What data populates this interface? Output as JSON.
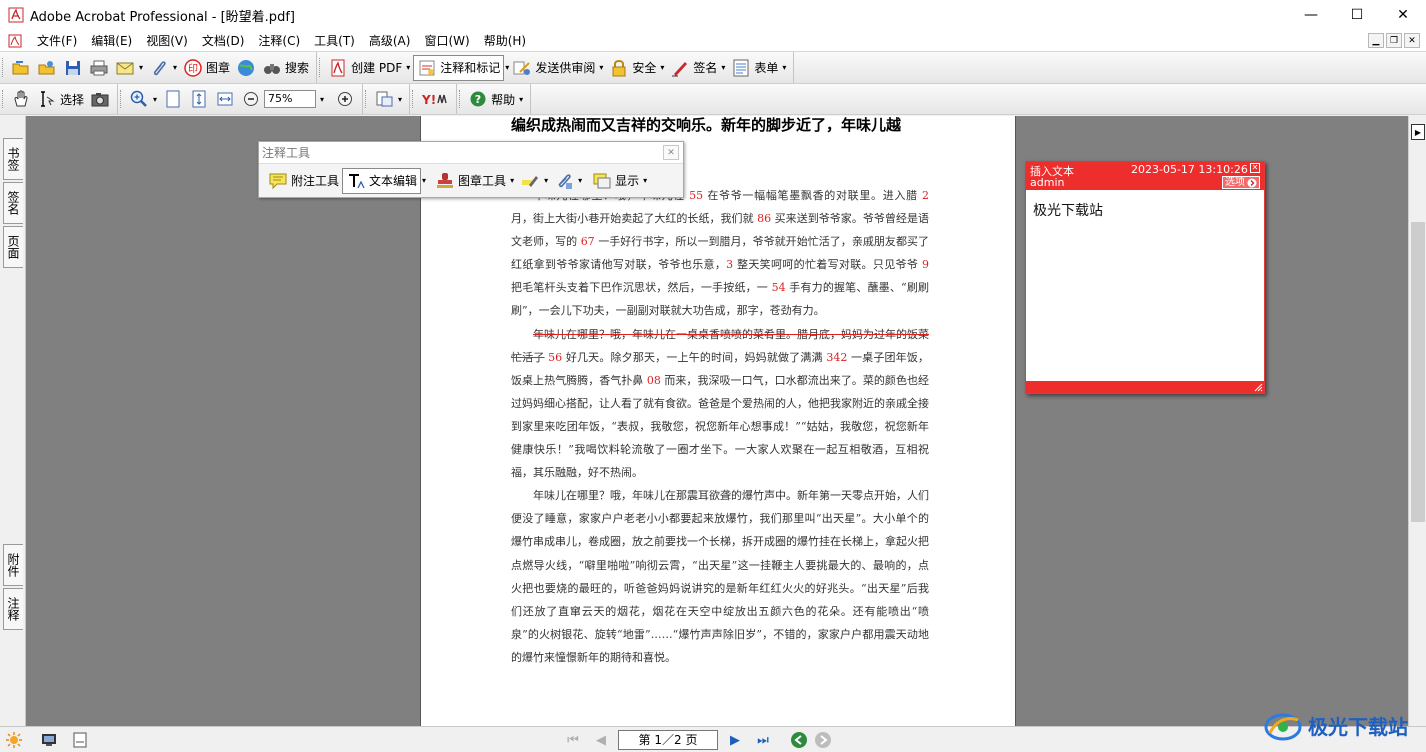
{
  "window": {
    "title": "Adobe Acrobat Professional - [盼望着.pdf]",
    "min": "—",
    "max": "☐",
    "close": "✕"
  },
  "menu": [
    "文件(F)",
    "编辑(E)",
    "视图(V)",
    "文档(D)",
    "注释(C)",
    "工具(T)",
    "高级(A)",
    "窗口(W)",
    "帮助(H)"
  ],
  "toolbar1": {
    "stamp": "图章",
    "search": "搜索",
    "create_pdf": "创建 PDF",
    "comment_markup": "注释和标记",
    "send_review": "发送供审阅",
    "security": "安全",
    "sign": "签名",
    "forms": "表单"
  },
  "toolbar2": {
    "select": "选择",
    "zoom_value": "75%",
    "help": "帮助"
  },
  "nav_tabs": {
    "bookmarks": "书签",
    "signatures": "签名",
    "pages": "页面",
    "attachments": "附件",
    "comments": "注释"
  },
  "comment_toolbar": {
    "title": "注释工具",
    "note_tool": "附注工具",
    "text_edit": "文本编辑",
    "stamp_tool": "图章工具",
    "show": "显示"
  },
  "sticky_note": {
    "type_label": "插入文本",
    "author": "admin",
    "timestamp": "2023-05-17 13:10:26",
    "options_label": "选项",
    "content": "极光下载站"
  },
  "document": {
    "heading": "编织成热闹而又吉祥的交响乐。新年的脚步近了，年味儿越",
    "p1": [
      {
        "t": "年味儿在哪里？哦，年味儿在 "
      },
      {
        "n": "55"
      },
      {
        "t": " 在爷爷一幅幅笔墨飘香的对联里。进入腊 "
      },
      {
        "n": "2"
      },
      {
        "t": " 月，街上大街小巷开始卖起了大红的长纸，我们就 "
      },
      {
        "n": "86"
      },
      {
        "t": " 买来送到爷爷家。爷爷曾经是语文老师，写的 "
      },
      {
        "n": "67"
      },
      {
        "t": " 一手好行书字，所以一到腊月，爷爷就开始忙活了，亲戚朋友都买了红纸拿到爷爷家请他写对联，爷爷也乐意，"
      },
      {
        "n": "3"
      },
      {
        "t": " 整天笑呵呵的忙着写对联。只见爷爷 "
      },
      {
        "n": "9"
      },
      {
        "t": " 把毛笔杆头支着下巴作沉思状，然后，一手按纸，一 "
      },
      {
        "n": "54"
      },
      {
        "t": " 手有力的握笔、蘸墨、“刷刷刷”，一会儿下功夫，一副副对联就大功告成，那字，苍劲有力。"
      }
    ],
    "p2": [
      {
        "s": "年味儿在哪里？哦，年味儿在一桌桌香喷喷的菜肴里。腊月底，妈妈为过年的饭菜忙活了"
      },
      {
        "t": " "
      },
      {
        "n": "56"
      },
      {
        "t": " 好几天。除夕那天，一上午的时间，妈妈就做了满满 "
      },
      {
        "n": "342"
      },
      {
        "t": " 一桌子团年饭，饭桌上热气腾腾，香气扑鼻 "
      },
      {
        "n": "08"
      },
      {
        "t": " 而来，我深吸一口气，口水都流出来了。菜的颜色也经过妈妈细心搭配，让人看了就有食欲。爸爸是个爱热闹的人，他把我家附近的亲戚全接到家里来吃团年饭，“表叔，我敬您，祝您新年心想事成！”“姑姑，我敬您，祝您新年健康快乐！”我喝饮料轮流敬了一圈才坐下。一大家人欢聚在一起互相敬酒，互相祝福，其乐融融，好不热闹。"
      }
    ],
    "p3": [
      {
        "t": "年味儿在哪里？哦，年味儿在那震耳欲聋的爆竹声中。新年第一天零点开始，人们便没了睡意，家家户户老老小小都要起来放爆竹，我们那里叫“出天星”。大小单个的爆竹串成串儿，卷成圈，放之前要找一个长梯，拆开成圈的爆竹挂在长梯上，拿起火把点燃导火线，“噼里啪啦”响彻云霄，“出天星”这一挂鞭主人要挑最大的、最响的，点火把也要烧的最旺的，听爸爸妈妈说讲究的是新年红红火火的好兆头。“出天星”后我们还放了直窜云天的烟花，烟花在天空中绽放出五颜六色的花朵。还有能喷出“喷泉”的火树银花、旋转“地雷”……“爆竹声声除旧岁”，不错的，家家户户都用震天动地的爆竹来憧憬新年的期待和喜悦。"
      }
    ]
  },
  "statusbar": {
    "page_field": "第 1／2 页"
  },
  "watermark": "极光下载站",
  "colors": {
    "note_red": "#ee2d2d",
    "number_red": "#e02020",
    "doc_bg": "#808080"
  }
}
